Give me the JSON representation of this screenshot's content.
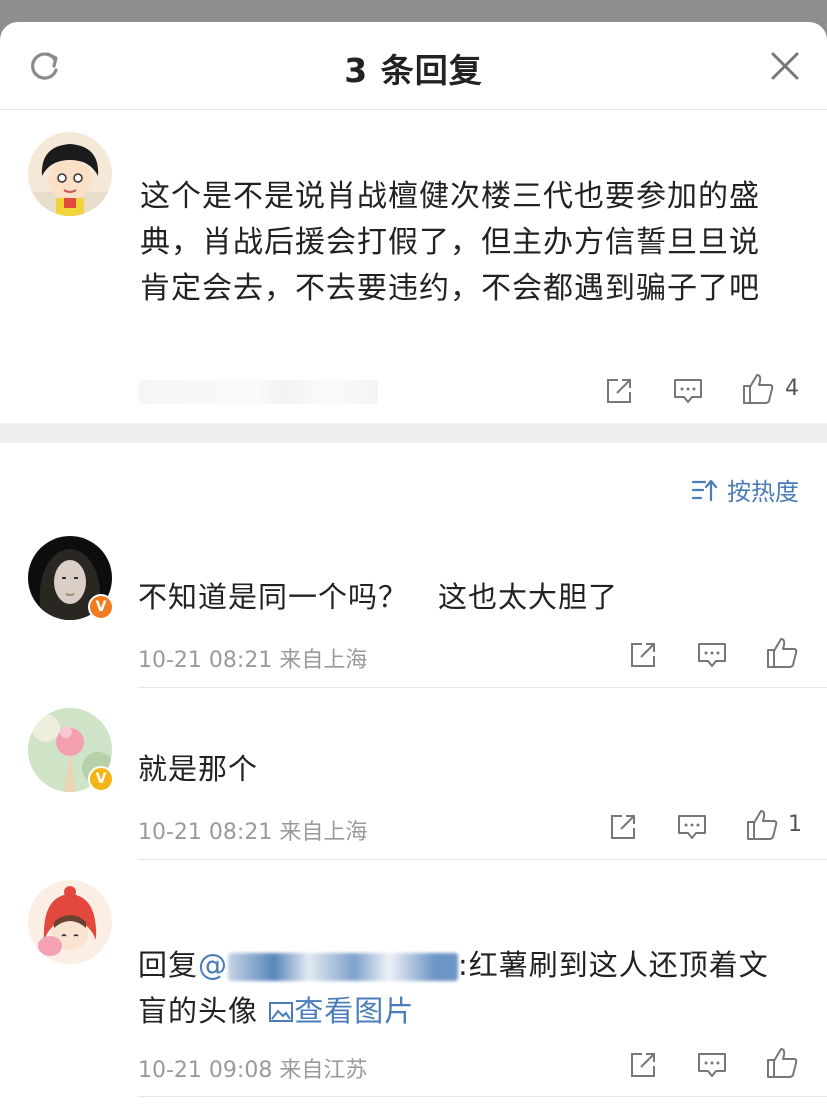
{
  "header": {
    "title": "3 条回复",
    "refresh_icon": "refresh-icon",
    "close_icon": "close-icon"
  },
  "main_comment": {
    "text": "这个是不是说肖战檀健次楼三代也要参加的盛典，肖战后援会打假了，但主办方信誓旦旦说肯定会去，不去要违约，不会都遇到骗子了吧",
    "like_count": "4"
  },
  "sort": {
    "label": "按热度",
    "icon": "sort-icon"
  },
  "replies": [
    {
      "text": "不知道是同一个吗？　这也太大胆了",
      "time": "10-21 08:21",
      "location": "来自上海",
      "like_count": "",
      "badge_color": "#f07c1f"
    },
    {
      "text": "就是那个",
      "time": "10-21 08:21",
      "location": "来自上海",
      "like_count": "1",
      "badge_color": "#f5b316"
    },
    {
      "reply_prefix": "回复",
      "mention_prefix": "@",
      "text_after_mention": ":红薯刷到这人还顶着文盲的头像",
      "image_link": "查看图片",
      "time": "10-21 09:08",
      "location": "来自江苏",
      "like_count": ""
    }
  ],
  "colors": {
    "link": "#4a7cb9",
    "meta": "#9a9a9a",
    "divider": "#efefef"
  }
}
